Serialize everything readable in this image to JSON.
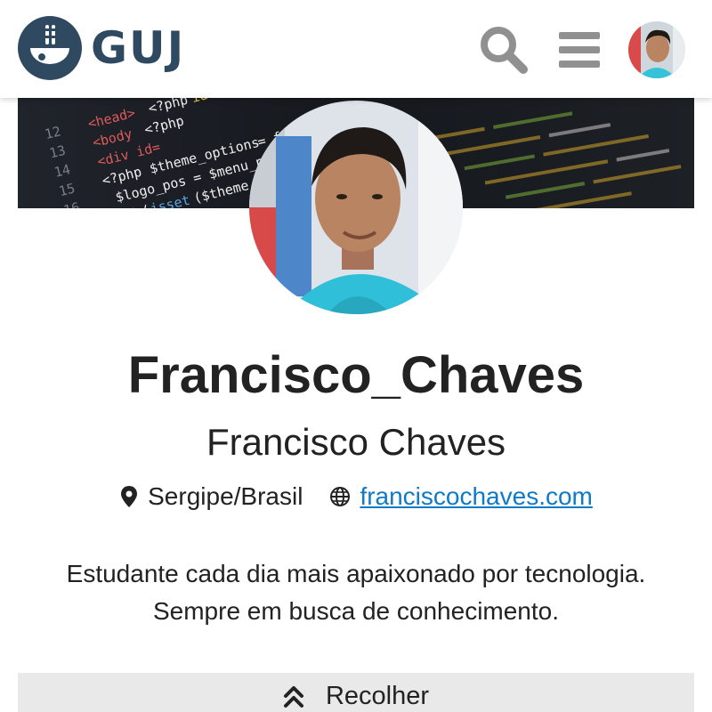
{
  "header": {
    "logo_text": "GUJ",
    "search_icon": "search-icon",
    "menu_icon": "hamburger-menu-icon",
    "avatar": "user-avatar"
  },
  "banner": {
    "description_icon": "code-background-image"
  },
  "profile": {
    "username": "Francisco_Chaves",
    "full_name": "Francisco Chaves",
    "location": "Sergipe/Brasil",
    "website": "franciscochaves.com",
    "bio_line_1": "Estudante cada dia mais apaixonado por tecnologia.",
    "bio_line_2": "Sempre em busca de conhecimento."
  },
  "collapse": {
    "label": "Recolher",
    "icon": "chevron-double-up-icon"
  },
  "colors": {
    "brand": "#2f4a60",
    "link": "#0f7ac6",
    "icon_gray": "#909090",
    "collapse_bg": "#e9e9e9"
  }
}
